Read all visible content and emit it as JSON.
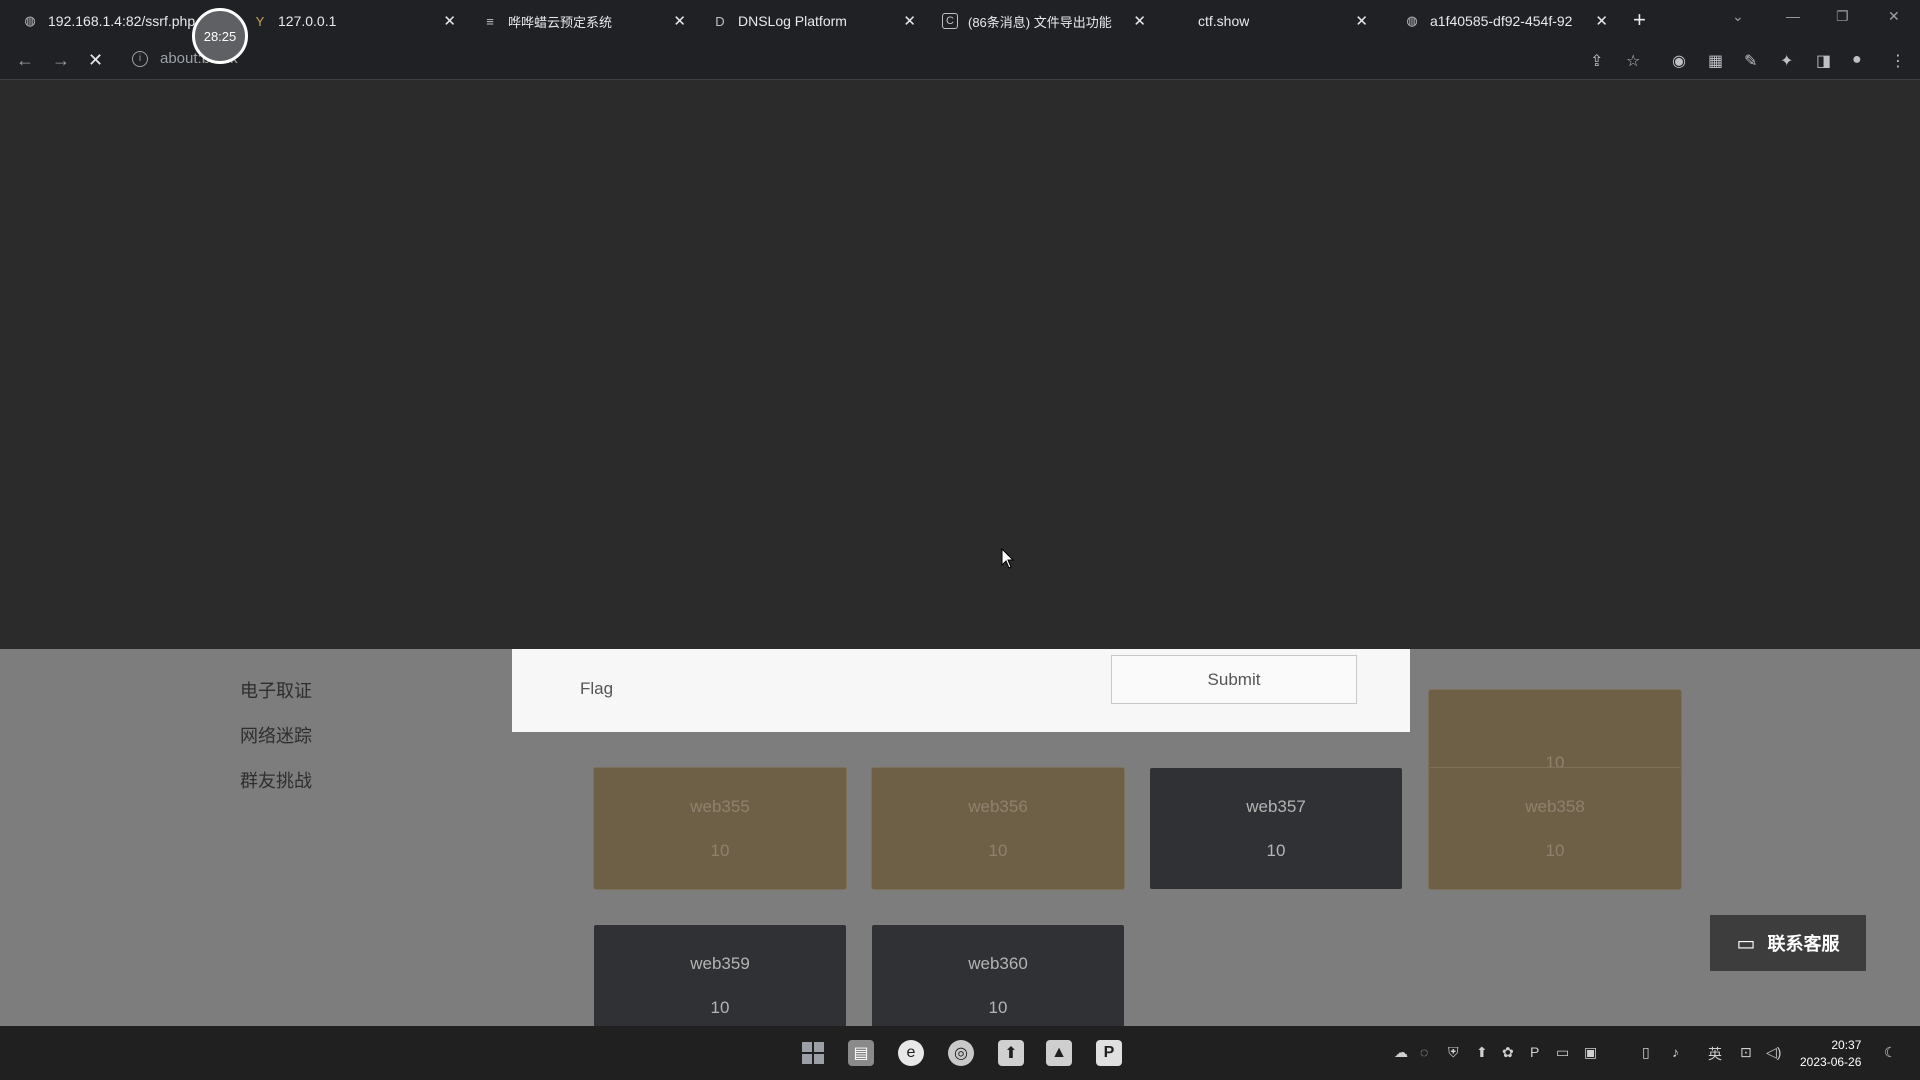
{
  "browser": {
    "tabs": [
      {
        "title": "192.168.1.4:82/ssrf.php",
        "icon": "globe-icon",
        "glyph": "◍"
      },
      {
        "title": "127.0.0.1",
        "icon": "y-logo-icon",
        "glyph": "Y"
      },
      {
        "title": "哗哗蜡云预定系统",
        "icon": "doc-icon",
        "glyph": "≡"
      },
      {
        "title": "DNSLog Platform",
        "icon": "d-logo-icon",
        "glyph": "D"
      },
      {
        "title": "(86条消息) 文件导出功能",
        "icon": "c-logo-icon",
        "glyph": "C"
      },
      {
        "title": "ctf.show",
        "icon": "",
        "glyph": ""
      },
      {
        "title": "a1f40585-df92-454f-92",
        "icon": "globe-icon",
        "glyph": "◍"
      }
    ],
    "timer": "28:25",
    "address": "about:blank"
  },
  "sidebar": {
    "items": [
      "电子取证",
      "网络迷踪",
      "群友挑战"
    ]
  },
  "flag_form": {
    "label": "Flag",
    "submit_label": "Submit"
  },
  "challenges": [
    {
      "name": "",
      "score": "10",
      "style": "brown"
    },
    {
      "name": "web355",
      "score": "10",
      "style": "brown"
    },
    {
      "name": "web356",
      "score": "10",
      "style": "brown"
    },
    {
      "name": "web357",
      "score": "10",
      "style": "dark"
    },
    {
      "name": "web358",
      "score": "10",
      "style": "brown"
    },
    {
      "name": "web359",
      "score": "10",
      "style": "dark"
    },
    {
      "name": "web360",
      "score": "10",
      "style": "dark"
    }
  ],
  "contact_button": {
    "label": "联系客服"
  },
  "taskbar": {
    "time": "20:37",
    "date": "2023-06-26",
    "ime": "英"
  }
}
